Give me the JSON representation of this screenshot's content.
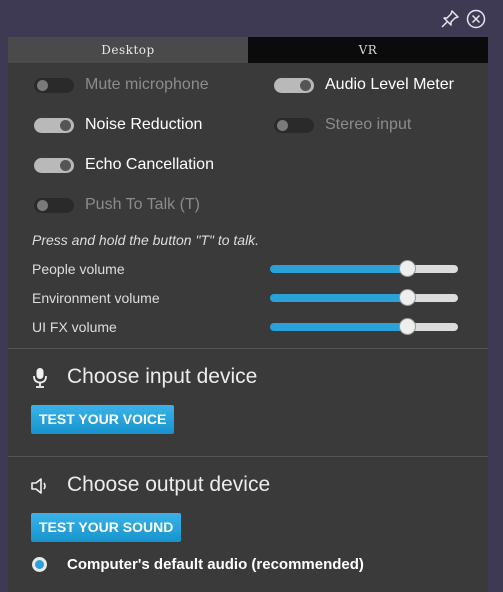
{
  "window": {
    "pin_icon": "pin-icon",
    "close_icon": "close-icon"
  },
  "tabs": [
    {
      "label": "Desktop",
      "active": true
    },
    {
      "label": "VR",
      "active": false
    }
  ],
  "toggles": {
    "mute_microphone": {
      "label": "Mute microphone",
      "on": false
    },
    "audio_level_meter": {
      "label": "Audio Level Meter",
      "on": true
    },
    "noise_reduction": {
      "label": "Noise Reduction",
      "on": true
    },
    "stereo_input": {
      "label": "Stereo input",
      "on": false
    },
    "echo_cancellation": {
      "label": "Echo Cancellation",
      "on": true
    },
    "push_to_talk": {
      "label": "Push To Talk (T)",
      "on": false
    }
  },
  "hint": "Press and hold the button \"T\" to talk.",
  "volumes": {
    "people": {
      "label": "People volume",
      "value": 0.73
    },
    "environment": {
      "label": "Environment volume",
      "value": 0.73
    },
    "ui_fx": {
      "label": "UI FX volume",
      "value": 0.73
    }
  },
  "input_section": {
    "title": "Choose input device",
    "icon": "microphone-icon",
    "button": "TEST YOUR VOICE"
  },
  "output_section": {
    "title": "Choose output device",
    "icon": "speaker-icon",
    "button": "TEST YOUR SOUND",
    "selected_device": "Computer's default audio (recommended)"
  },
  "colors": {
    "accent": "#2aa2d9",
    "panel": "#3a3a3a",
    "tab_active": "#4a4a4a",
    "tab_inactive": "#0b0b0b"
  }
}
